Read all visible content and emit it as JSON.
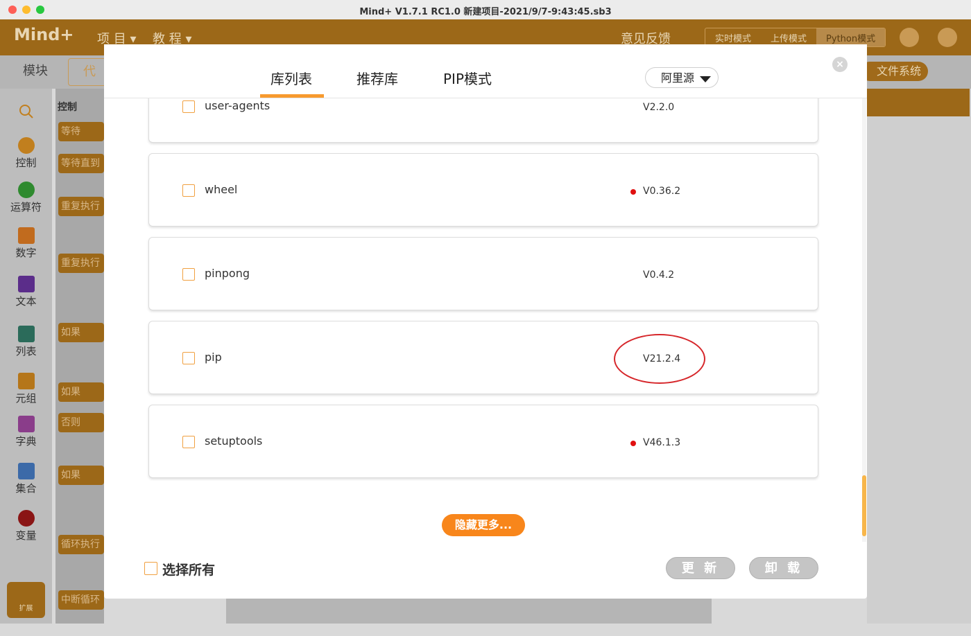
{
  "window": {
    "title": "Mind+ V1.7.1 RC1.0   新建项目-2021/9/7-9:43:45.sb3"
  },
  "app": {
    "logo": "Mind+",
    "menu": [
      "项 目 ▾",
      "教 程 ▾"
    ],
    "feedback": "意见反馈",
    "modes": [
      "实时模式",
      "上传模式",
      "Python模式"
    ],
    "active_mode": "Python模式",
    "tabs": {
      "modules": "模块",
      "code": "代"
    },
    "file_system": "文件系统",
    "palette_title": "控制",
    "categories": [
      "控制",
      "运算符",
      "数字",
      "文本",
      "列表",
      "元组",
      "字典",
      "集合",
      "变量"
    ],
    "category_colors": [
      "#c17f1e",
      "#2f8a2f",
      "#c16b1e",
      "#5b2d8a",
      "#2b6b5a",
      "#b5761a",
      "#8a3d8a",
      "#3c6aa8",
      "#8a1515"
    ],
    "blocks": [
      "等待",
      "等待直到",
      "重复执行",
      "重复执行",
      "如果",
      "如果",
      "否则",
      "如果",
      "循环执行",
      "中断循环"
    ],
    "extension": "扩展"
  },
  "modal": {
    "tabs": [
      "库列表",
      "推荐库",
      "PIP模式"
    ],
    "active_tab": "库列表",
    "source": "阿里源",
    "close_icon": "close-icon",
    "packages": [
      {
        "name": "user-agents",
        "version": "V2.2.0",
        "update_available": false
      },
      {
        "name": "wheel",
        "version": "V0.36.2",
        "update_available": true
      },
      {
        "name": "pinpong",
        "version": "V0.4.2",
        "update_available": false
      },
      {
        "name": "pip",
        "version": "V21.2.4",
        "update_available": false,
        "highlighted": true
      },
      {
        "name": "setuptools",
        "version": "V46.1.3",
        "update_available": true
      }
    ],
    "hide_more": "隐藏更多...",
    "select_all": "选择所有",
    "update_button": "更 新",
    "uninstall_button": "卸 载",
    "accent_color": "#f8861b",
    "highlight_ring_color": "#d6262a",
    "update_dot_color": "#e01010"
  }
}
